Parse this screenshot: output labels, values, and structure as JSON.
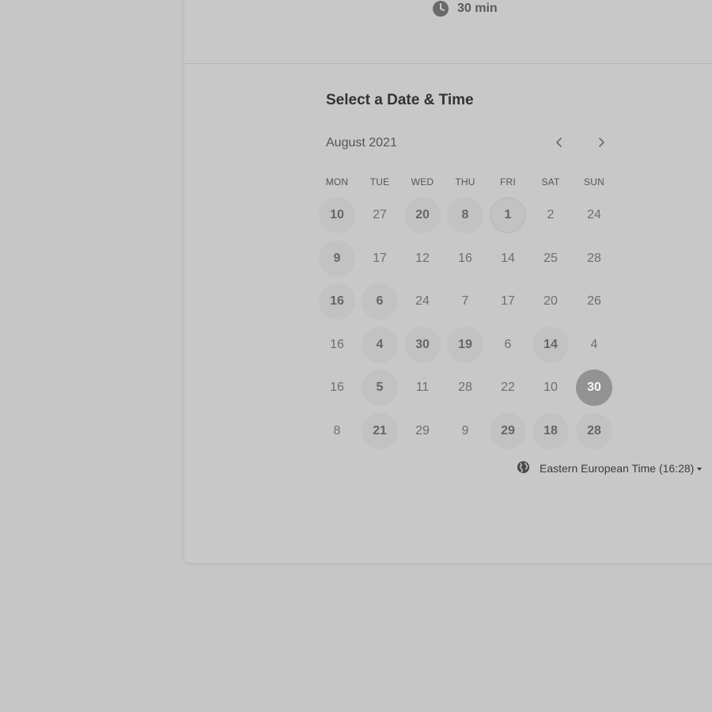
{
  "event": {
    "duration": "30 min",
    "duration_icon": "clock-icon"
  },
  "scheduler": {
    "title": "Select a Date & Time",
    "month": "August 2021",
    "prev_icon": "chevron-left-icon",
    "next_icon": "chevron-right-icon",
    "weekdays": [
      "MON",
      "TUE",
      "WED",
      "THU",
      "FRI",
      "SAT",
      "SUN"
    ],
    "weeks": [
      [
        {
          "day": "10",
          "state": "available"
        },
        {
          "day": "27",
          "state": "unavailable"
        },
        {
          "day": "20",
          "state": "available"
        },
        {
          "day": "8",
          "state": "available"
        },
        {
          "day": "1",
          "state": "available-today"
        },
        {
          "day": "2",
          "state": "unavailable"
        },
        {
          "day": "24",
          "state": "unavailable"
        }
      ],
      [
        {
          "day": "9",
          "state": "available"
        },
        {
          "day": "17",
          "state": "unavailable"
        },
        {
          "day": "12",
          "state": "unavailable"
        },
        {
          "day": "16",
          "state": "unavailable"
        },
        {
          "day": "14",
          "state": "unavailable"
        },
        {
          "day": "25",
          "state": "unavailable"
        },
        {
          "day": "28",
          "state": "unavailable"
        }
      ],
      [
        {
          "day": "16",
          "state": "available"
        },
        {
          "day": "6",
          "state": "available"
        },
        {
          "day": "24",
          "state": "unavailable"
        },
        {
          "day": "7",
          "state": "unavailable"
        },
        {
          "day": "17",
          "state": "unavailable"
        },
        {
          "day": "20",
          "state": "unavailable"
        },
        {
          "day": "26",
          "state": "unavailable"
        }
      ],
      [
        {
          "day": "16",
          "state": "unavailable"
        },
        {
          "day": "4",
          "state": "available"
        },
        {
          "day": "30",
          "state": "available"
        },
        {
          "day": "19",
          "state": "available"
        },
        {
          "day": "6",
          "state": "unavailable"
        },
        {
          "day": "14",
          "state": "available"
        },
        {
          "day": "4",
          "state": "unavailable"
        }
      ],
      [
        {
          "day": "16",
          "state": "unavailable"
        },
        {
          "day": "5",
          "state": "available"
        },
        {
          "day": "11",
          "state": "unavailable"
        },
        {
          "day": "28",
          "state": "unavailable"
        },
        {
          "day": "22",
          "state": "unavailable"
        },
        {
          "day": "10",
          "state": "unavailable"
        },
        {
          "day": "30",
          "state": "selected"
        }
      ],
      [
        {
          "day": "8",
          "state": "unavailable"
        },
        {
          "day": "21",
          "state": "available"
        },
        {
          "day": "29",
          "state": "unavailable"
        },
        {
          "day": "9",
          "state": "unavailable"
        },
        {
          "day": "29",
          "state": "available"
        },
        {
          "day": "18",
          "state": "available"
        },
        {
          "day": "28",
          "state": "available"
        }
      ]
    ],
    "timezone": {
      "label": "Eastern European Time (16:28)",
      "icon": "globe-icon"
    }
  }
}
